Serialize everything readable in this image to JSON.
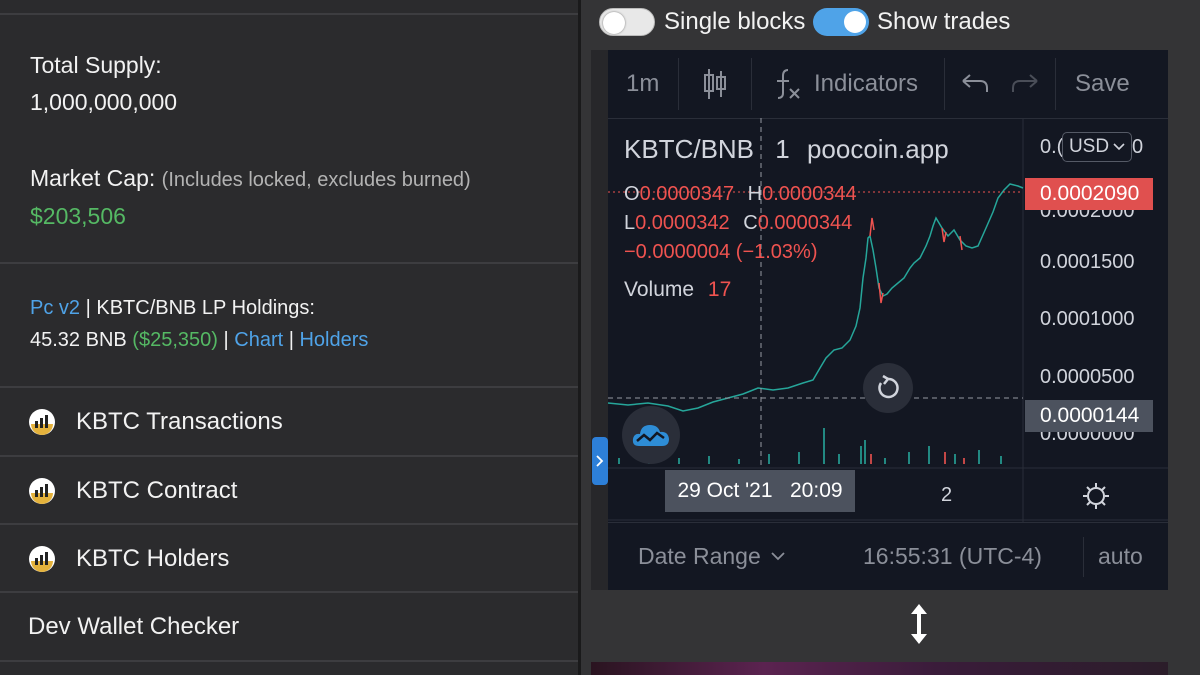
{
  "left": {
    "total_supply_label": "Total Supply:",
    "total_supply_value": "1,000,000,000",
    "market_cap_label": "Market Cap:",
    "market_cap_note": "(Includes locked, excludes burned)",
    "market_cap_value": "$203,506",
    "lp": {
      "pc_link": "Pc v2",
      "sep1": "|",
      "holdings_label": "KBTC/BNB LP Holdings:",
      "bnb_amount": "45.32 BNB",
      "usd_amount": "($25,350)",
      "sep2": "|",
      "chart_link": "Chart",
      "sep3": "|",
      "holders_link": "Holders"
    },
    "menu": [
      {
        "label": "KBTC Transactions",
        "icon": "poocoin-icon"
      },
      {
        "label": "KBTC Contract",
        "icon": "poocoin-icon"
      },
      {
        "label": "KBTC Holders",
        "icon": "poocoin-icon"
      },
      {
        "label": "Dev Wallet Checker",
        "icon": ""
      }
    ]
  },
  "right": {
    "toggle_single_blocks": {
      "label": "Single blocks",
      "on": false
    },
    "toggle_show_trades": {
      "label": "Show trades",
      "on": true
    },
    "toolbar": {
      "interval": "1m",
      "indicators": "Indicators",
      "save": "Save"
    },
    "legend": {
      "pair": "KBTC/BNB",
      "interval": "1",
      "source": "poocoin.app",
      "o_label": "O",
      "o_value": "0.0000347",
      "h_label": "H",
      "h_value": "0.0000344",
      "l_label": "L",
      "l_value": "0.0000342",
      "c_label": "C",
      "c_value": "0.0000344",
      "change": "−0.0000004 (−1.03%)",
      "volume_label": "Volume",
      "volume_value": "17"
    },
    "currency": "USD",
    "price_axis": {
      "top_partial": "0.(",
      "top_partial_right": "0",
      "ticks": [
        "0.0001500",
        "0.0001000",
        "0.0000500"
      ],
      "bottom_partial": "0.0000000",
      "last_price": "0.0002090",
      "last_price_hidden": "0.0002000",
      "crosshair_price": "0.0000144"
    },
    "time_axis": {
      "crosshair_time": "29 Oct '21   20:09",
      "tick": "2"
    },
    "footer": {
      "date_range": "Date Range",
      "clock": "16:55:31 (UTC-4)",
      "auto": "auto"
    },
    "colors": {
      "up": "#26a69a",
      "down": "#ef5350",
      "last_price_bg": "#e0504f",
      "accent_blue": "#4fa3e8",
      "green_text": "#55b964"
    }
  }
}
